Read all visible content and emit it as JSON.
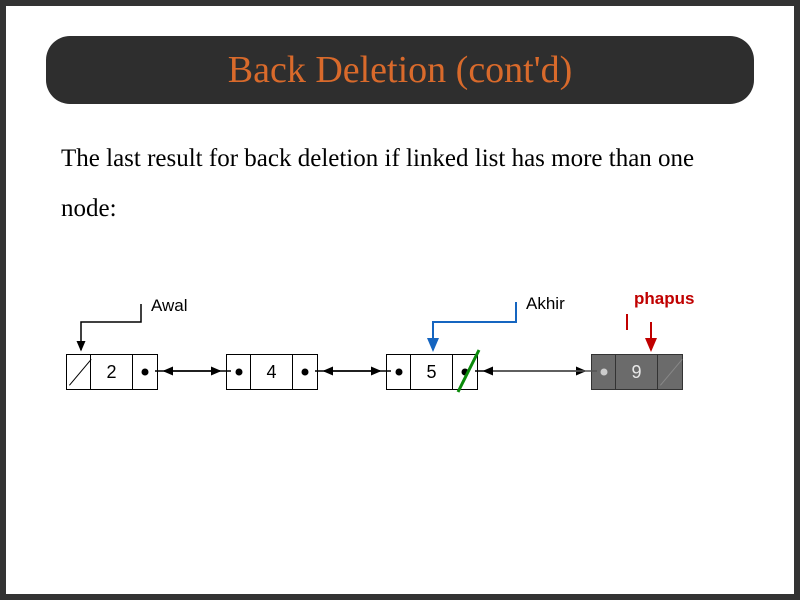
{
  "title": "Back Deletion (cont'd)",
  "body": "The last result for back deletion if linked list has more than one node:",
  "labels": {
    "awal": "Awal",
    "akhir": "Akhir",
    "phapus": "phapus"
  },
  "nodes": [
    {
      "value": "2",
      "prev_null": true,
      "next_null": false,
      "deleted": false
    },
    {
      "value": "4",
      "prev_null": false,
      "next_null": false,
      "deleted": false
    },
    {
      "value": "5",
      "prev_null": false,
      "next_null": false,
      "deleted": false,
      "next_cut": true
    },
    {
      "value": "9",
      "prev_null": false,
      "next_null": true,
      "deleted": true
    }
  ]
}
